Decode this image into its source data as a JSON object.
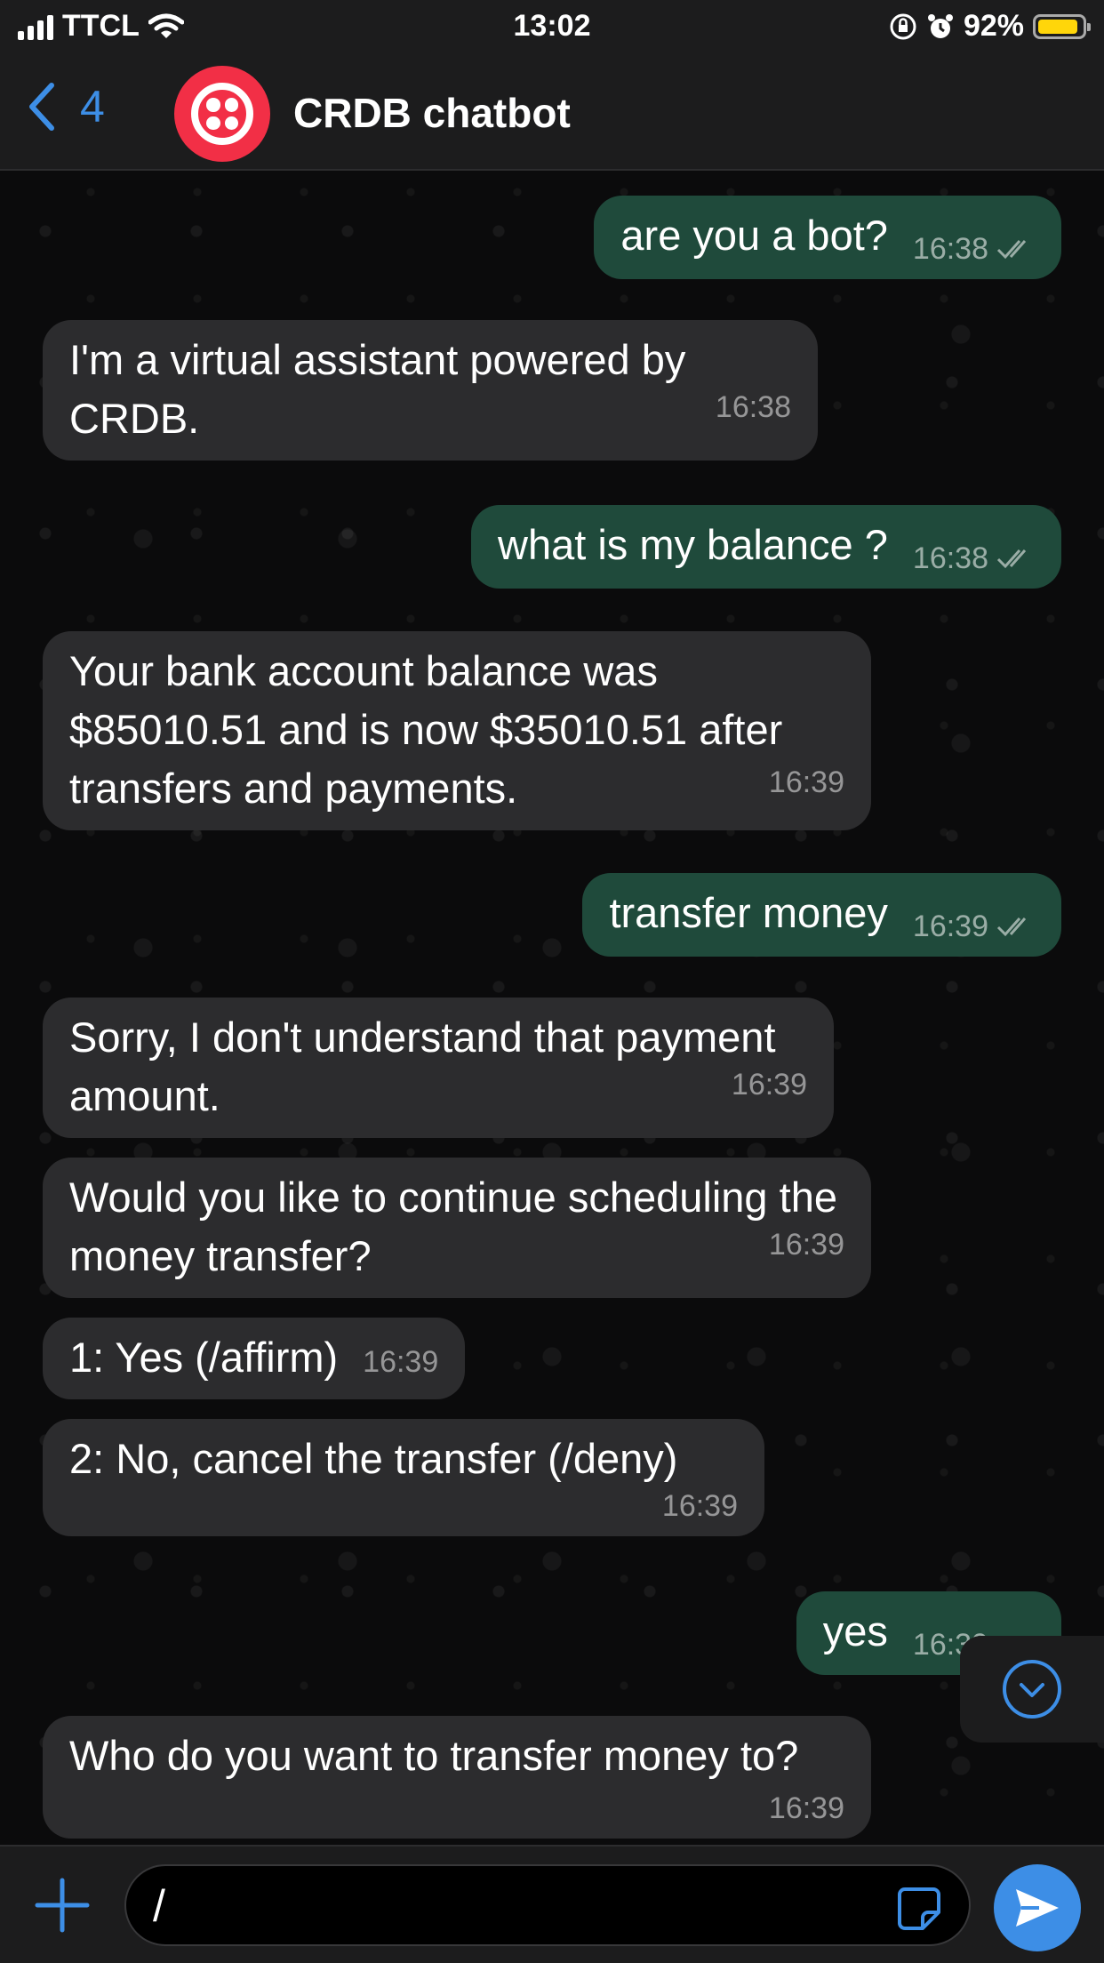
{
  "status_bar": {
    "carrier": "TTCL",
    "time": "13:02",
    "battery_percent": "92%",
    "battery_level": 0.92
  },
  "header": {
    "back_count": "4",
    "title": "CRDB chatbot"
  },
  "messages": [
    {
      "dir": "out",
      "text": "are you a bot?",
      "time": "16:38",
      "read": true
    },
    {
      "dir": "in",
      "text": "I'm a virtual assistant powered by CRDB.",
      "time": "16:38"
    },
    {
      "dir": "out",
      "text": "what is my balance ?",
      "time": "16:38",
      "read": true
    },
    {
      "dir": "in",
      "text": "Your bank account balance was $85010.51 and is now $35010.51 after transfers and payments.",
      "time": "16:39"
    },
    {
      "dir": "out",
      "text": "transfer money",
      "time": "16:39",
      "read": true
    },
    {
      "dir": "in",
      "text": "Sorry, I don't understand that payment amount.",
      "time": "16:39"
    },
    {
      "dir": "in",
      "text": "Would you like to continue scheduling the money transfer?",
      "time": "16:39"
    },
    {
      "dir": "in",
      "text": "1: Yes (/affirm)",
      "time": "16:39"
    },
    {
      "dir": "in",
      "text": "2: No, cancel the transfer (/deny)",
      "time": "16:39"
    },
    {
      "dir": "out",
      "text": "yes",
      "time": "16:39",
      "read": true
    },
    {
      "dir": "in",
      "text": "Who do you want to transfer money to?",
      "time": "16:39"
    }
  ],
  "composer": {
    "value": "/"
  },
  "colors": {
    "accent": "#3d8ee6",
    "outgoing_bubble": "#1f4a3b",
    "incoming_bubble": "#2c2c2e",
    "avatar": "#f22f46",
    "battery": "#ffd60a"
  }
}
